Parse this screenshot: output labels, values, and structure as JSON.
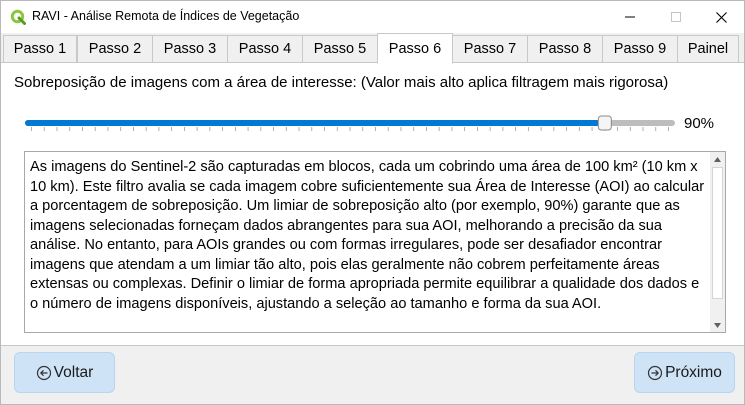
{
  "window": {
    "title": "RAVI - Análise Remota de Índices de Vegetação"
  },
  "tabs": [
    {
      "label": "Passo 1",
      "active": false
    },
    {
      "label": "Passo 2",
      "active": false
    },
    {
      "label": "Passo 3",
      "active": false
    },
    {
      "label": "Passo 4",
      "active": false
    },
    {
      "label": "Passo 5",
      "active": false
    },
    {
      "label": "Passo 6",
      "active": true
    },
    {
      "label": "Passo 7",
      "active": false
    },
    {
      "label": "Passo 8",
      "active": false
    },
    {
      "label": "Passo 9",
      "active": false
    },
    {
      "label": "Painel",
      "active": false
    }
  ],
  "overlap": {
    "label": "Sobreposição de imagens com a área de interesse: (Valor mais alto aplica filtragem mais rigorosa)",
    "value": 90,
    "value_text": "90%",
    "min": 0,
    "max": 100
  },
  "description": "As imagens do Sentinel-2 são capturadas em blocos, cada um cobrindo uma área de 100 km² (10 km x 10 km). Este filtro avalia se cada imagem cobre suficientemente sua Área de Interesse (AOI) ao calcular a porcentagem de sobreposição. Um limiar de sobreposição alto (por exemplo, 90%) garante que as imagens selecionadas forneçam dados abrangentes para sua AOI, melhorando a precisão da sua análise. No entanto, para AOIs grandes ou com formas irregulares, pode ser desafiador encontrar imagens que atendam a um limiar tão alto, pois elas geralmente não cobrem perfeitamente áreas extensas ou complexas. Definir o limiar de forma apropriada permite equilibrar a qualidade dos dados e o número de imagens disponíveis, ajustando a seleção ao tamanho e forma da sua AOI.",
  "buttons": {
    "back_label": "Voltar",
    "next_label": "Próximo"
  },
  "colors": {
    "accent": "#0078d4",
    "button_bg": "#cfe3f7",
    "app_icon": "#8cc63f"
  },
  "icons": {
    "app": "qgis-icon",
    "back": "arrow-left-circle-icon",
    "next": "arrow-right-circle-icon"
  }
}
